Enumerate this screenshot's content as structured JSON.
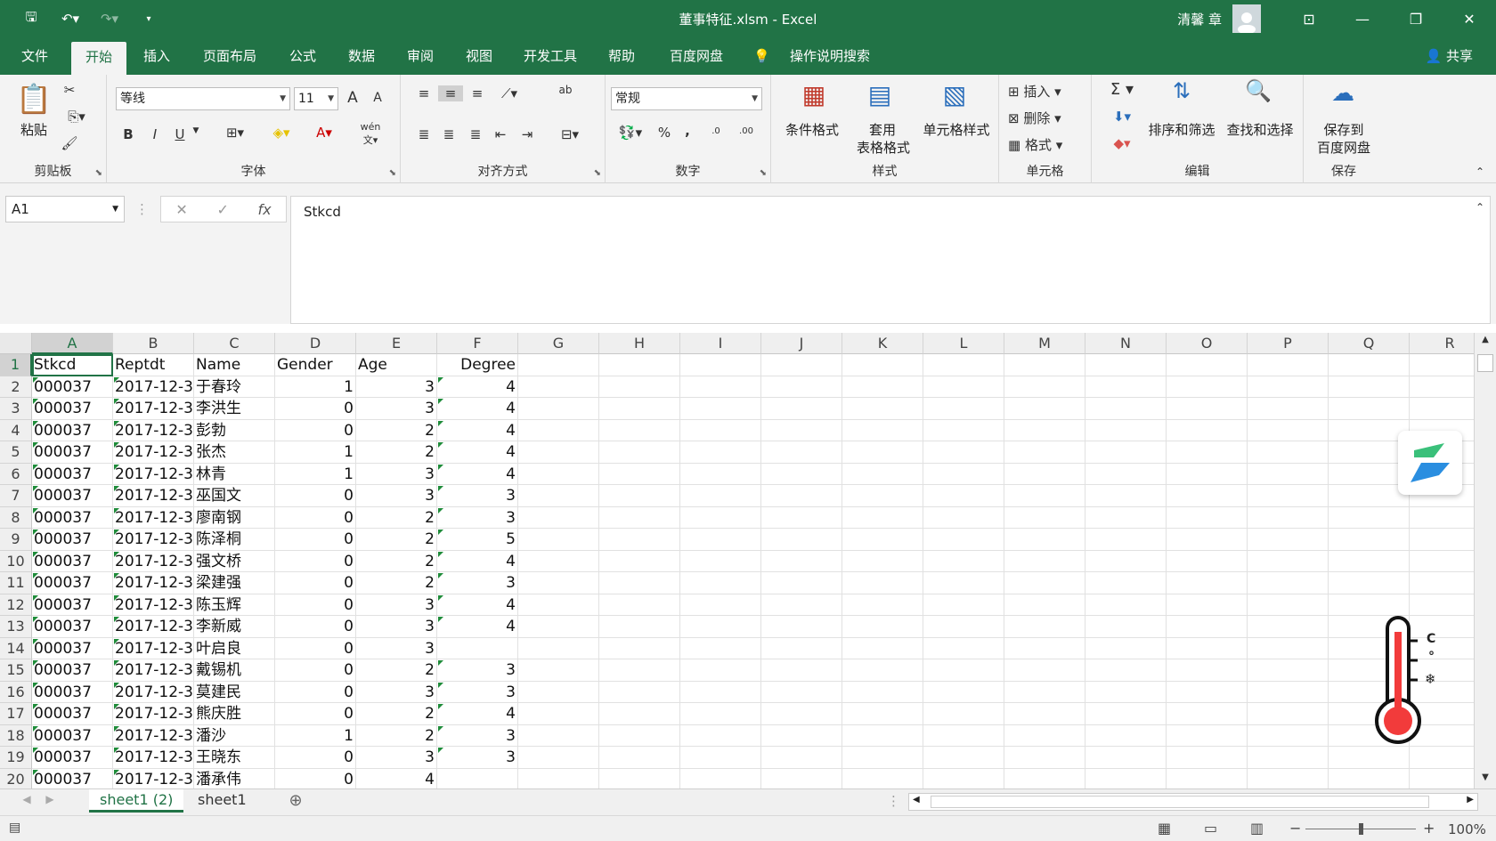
{
  "title": "董事特征.xlsm  -  Excel",
  "user": "清馨 章",
  "colors": {
    "accent": "#217346",
    "triangle": "#1f8c3a"
  },
  "tabs": [
    "文件",
    "开始",
    "插入",
    "页面布局",
    "公式",
    "数据",
    "审阅",
    "视图",
    "开发工具",
    "帮助",
    "百度网盘",
    "操作说明搜索"
  ],
  "share": "共享",
  "ribbon": {
    "clipboard": {
      "label": "剪贴板",
      "paste": "粘贴"
    },
    "font": {
      "label": "字体",
      "name": "等线",
      "size": "11",
      "grow": "A",
      "shrink": "A",
      "bold": "B",
      "italic": "I",
      "underline": "U",
      "phonetic": "wén"
    },
    "align": {
      "label": "对齐方式",
      "wrap": "ab"
    },
    "number": {
      "label": "数字",
      "format": "常规",
      "percent": "%",
      "comma": ",",
      "inc": ".0",
      "dec": ".00"
    },
    "styles": {
      "label": "样式",
      "cond": "条件格式",
      "table1": "套用",
      "table2": "表格格式",
      "cell": "单元格样式"
    },
    "cells": {
      "label": "单元格",
      "insert": "插入",
      "delete": "删除",
      "format": "格式"
    },
    "edit": {
      "label": "编辑",
      "sum": "Σ",
      "sort": "排序和筛选",
      "find": "查找和选择"
    },
    "save": {
      "label": "保存",
      "btn1": "保存到",
      "btn2": "百度网盘"
    }
  },
  "namebox": "A1",
  "formula": "Stkcd",
  "fx": "fx",
  "columns": [
    "A",
    "B",
    "C",
    "D",
    "E",
    "F",
    "G",
    "H",
    "I",
    "J",
    "K",
    "L",
    "M",
    "N",
    "O",
    "P",
    "Q",
    "R"
  ],
  "rows": [
    [
      "Stkcd",
      "Reptdt",
      "Name",
      "Gender",
      "Age",
      "Degree"
    ],
    [
      "000037",
      "2017-12-3",
      "于春玲",
      "1",
      "3",
      "4"
    ],
    [
      "000037",
      "2017-12-3",
      "李洪生",
      "0",
      "3",
      "4"
    ],
    [
      "000037",
      "2017-12-3",
      "彭勃",
      "0",
      "2",
      "4"
    ],
    [
      "000037",
      "2017-12-3",
      "张杰",
      "1",
      "2",
      "4"
    ],
    [
      "000037",
      "2017-12-3",
      "林青",
      "1",
      "3",
      "4"
    ],
    [
      "000037",
      "2017-12-3",
      "巫国文",
      "0",
      "3",
      "3"
    ],
    [
      "000037",
      "2017-12-3",
      "廖南钢",
      "0",
      "2",
      "3"
    ],
    [
      "000037",
      "2017-12-3",
      "陈泽桐",
      "0",
      "2",
      "5"
    ],
    [
      "000037",
      "2017-12-3",
      "强文桥",
      "0",
      "2",
      "4"
    ],
    [
      "000037",
      "2017-12-3",
      "梁建强",
      "0",
      "2",
      "3"
    ],
    [
      "000037",
      "2017-12-3",
      "陈玉辉",
      "0",
      "3",
      "4"
    ],
    [
      "000037",
      "2017-12-3",
      "李新威",
      "0",
      "3",
      "4"
    ],
    [
      "000037",
      "2017-12-3",
      "叶启良",
      "0",
      "3",
      ""
    ],
    [
      "000037",
      "2017-12-3",
      "戴锡机",
      "0",
      "2",
      "3"
    ],
    [
      "000037",
      "2017-12-3",
      "莫建民",
      "0",
      "3",
      "3"
    ],
    [
      "000037",
      "2017-12-3",
      "熊庆胜",
      "0",
      "2",
      "4"
    ],
    [
      "000037",
      "2017-12-3",
      "潘沙",
      "1",
      "2",
      "3"
    ],
    [
      "000037",
      "2017-12-3",
      "王晓东",
      "0",
      "3",
      "3"
    ],
    [
      "000037",
      "2017-12-3",
      "潘承伟",
      "0",
      "4",
      ""
    ]
  ],
  "sheets": [
    "sheet1 (2)",
    "sheet1"
  ],
  "zoom": "100%",
  "thermo_labels": [
    "C",
    "°",
    "❄"
  ]
}
